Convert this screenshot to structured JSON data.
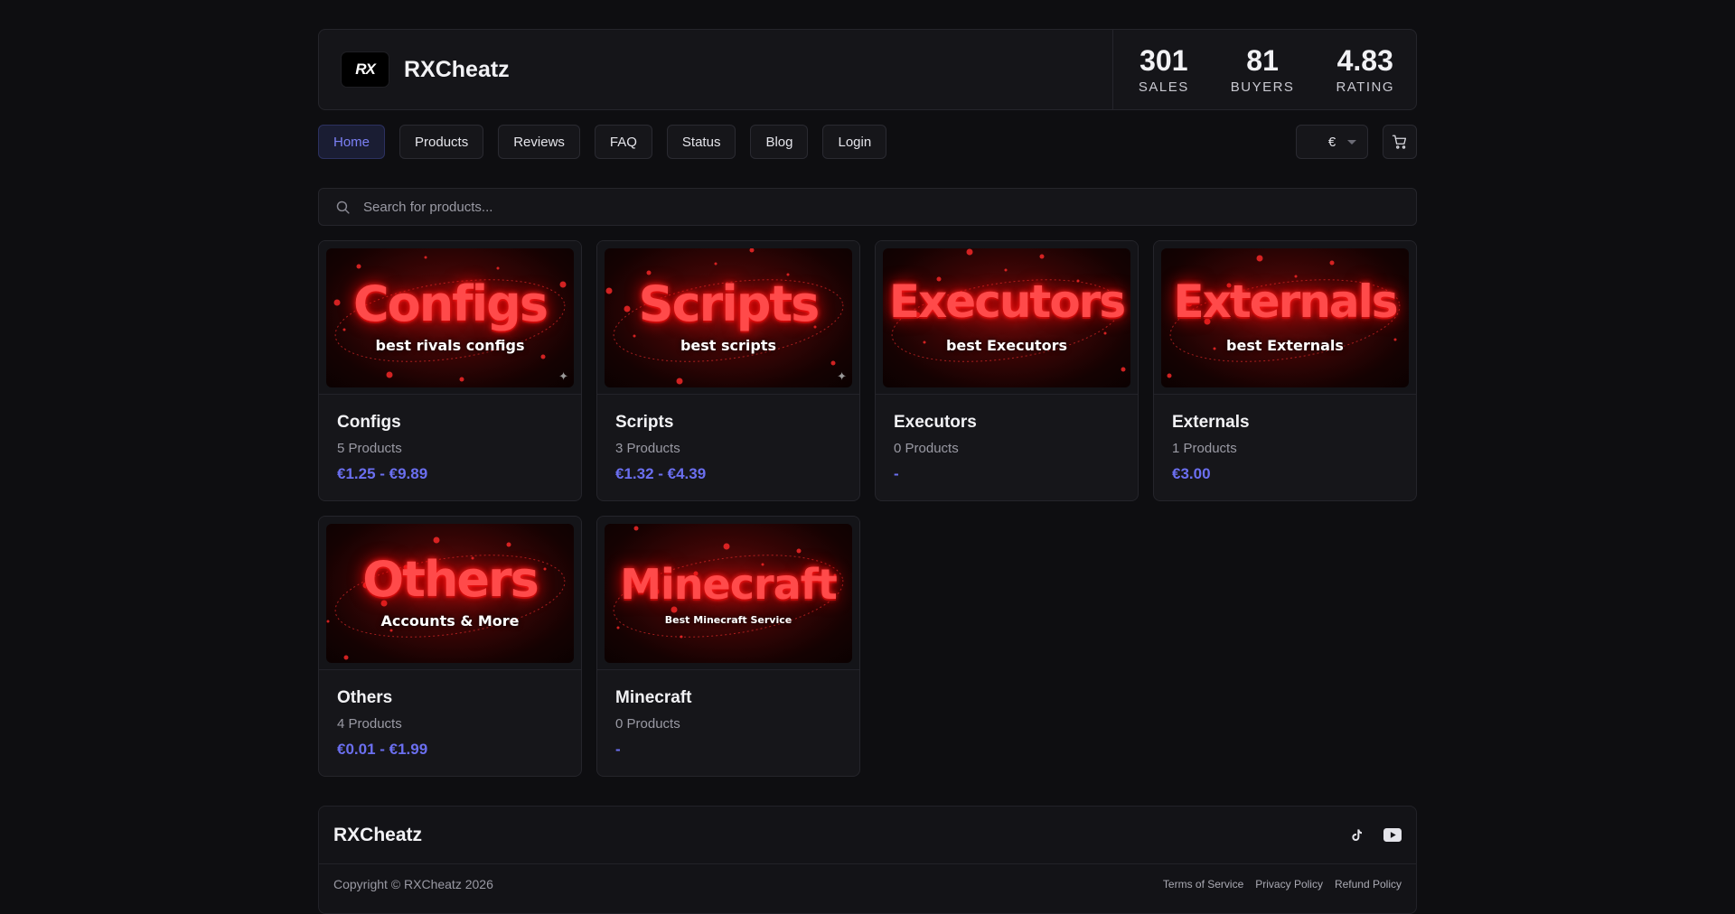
{
  "brand": {
    "logo_text": "RX",
    "name": "RXCheatz"
  },
  "stats": [
    {
      "value": "301",
      "label": "SALES"
    },
    {
      "value": "81",
      "label": "BUYERS"
    },
    {
      "value": "4.83",
      "label": "RATING"
    }
  ],
  "nav": {
    "items": [
      "Home",
      "Products",
      "Reviews",
      "FAQ",
      "Status",
      "Blog",
      "Login"
    ],
    "active": "Home",
    "currency": "€",
    "cart_icon": "cart-icon"
  },
  "search": {
    "placeholder": "Search for products...",
    "icon": "search-icon"
  },
  "categories": [
    {
      "title": "Configs",
      "count": "5 Products",
      "price": "€1.25 - €9.89",
      "banner_title": "Configs",
      "banner_sub": "best rivals configs"
    },
    {
      "title": "Scripts",
      "count": "3 Products",
      "price": "€1.32 - €4.39",
      "banner_title": "Scripts",
      "banner_sub": "best scripts"
    },
    {
      "title": "Executors",
      "count": "0 Products",
      "price": "-",
      "banner_title": "Executors",
      "banner_sub": "best Executors"
    },
    {
      "title": "Externals",
      "count": "1 Products",
      "price": "€3.00",
      "banner_title": "Externals",
      "banner_sub": "best Externals"
    },
    {
      "title": "Others",
      "count": "4 Products",
      "price": "€0.01 - €1.99",
      "banner_title": "Others",
      "banner_sub": "Accounts & More"
    },
    {
      "title": "Minecraft",
      "count": "0 Products",
      "price": "-",
      "banner_title": "Minecraft",
      "banner_sub": "Best Minecraft Service"
    }
  ],
  "colors": {
    "accent": "#6b6ff0",
    "banner_red": "#ff4a4a",
    "background": "#0e0e11"
  },
  "footer": {
    "brand": "RXCheatz",
    "copyright": "Copyright © RXCheatz 2026",
    "links": [
      "Terms of Service",
      "Privacy Policy",
      "Refund Policy"
    ],
    "social_icons": [
      "tiktok-icon",
      "youtube-icon"
    ]
  }
}
